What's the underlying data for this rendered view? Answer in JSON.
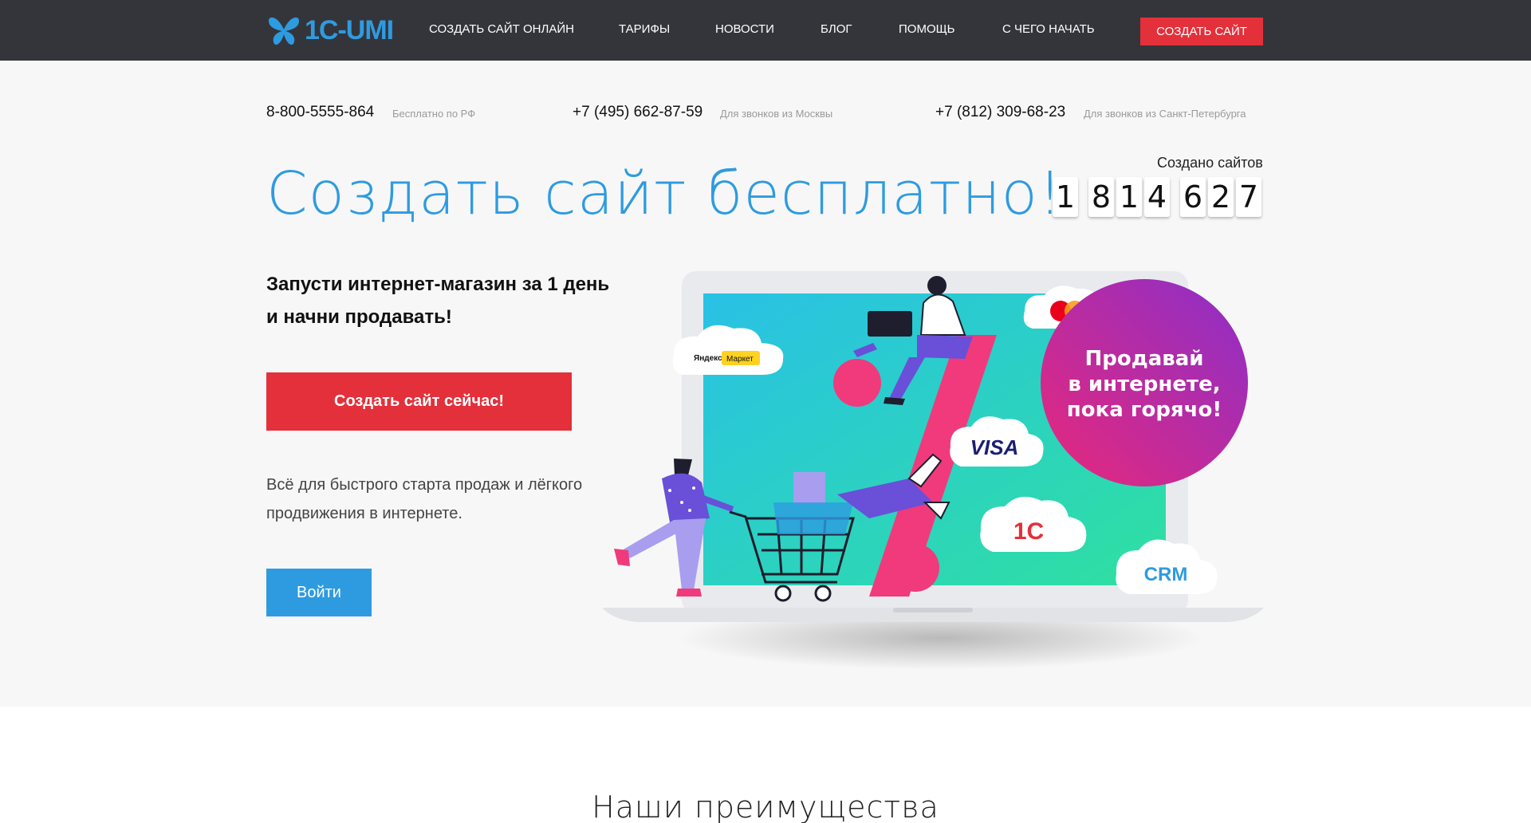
{
  "header": {
    "logo_text": "1C-UMI",
    "nav": [
      "СОЗДАТЬ САЙТ ОНЛАЙН",
      "ТАРИФЫ",
      "НОВОСТИ",
      "БЛОГ",
      "ПОМОЩЬ",
      "С ЧЕГО НАЧАТЬ"
    ],
    "cta_label": "СОЗДАТЬ САЙТ"
  },
  "phones": [
    {
      "number": "8-800-5555-864",
      "note": "Бесплатно по РФ"
    },
    {
      "number": "+7 (495) 662-87-59",
      "note": "Для звонков из Москвы"
    },
    {
      "number": "+7 (812) 309-68-23",
      "note": "Для звонков из Санкт-Петербурга"
    }
  ],
  "hero": {
    "headline": "Создать сайт бесплатно!",
    "counter_label": "Создано сайтов",
    "counter_digits": [
      "1",
      "8",
      "1",
      "4",
      "6",
      "2",
      "7"
    ],
    "sub_line1": "Запусти интернет-магазин за 1 день",
    "sub_line2": "и начни продавать!",
    "create_button": "Создать сайт сейчас!",
    "description": "Всё для быстрого старта продаж и лёгкого продвижения в интернете.",
    "login_button": "Войти"
  },
  "illustration": {
    "circle_line1": "Продавай",
    "circle_line2": "в интернете,",
    "circle_line3": "пока горячо!",
    "cloud_yandex_1": "Яндекс",
    "cloud_yandex_2": "Маркет",
    "cloud_visa": "VISA",
    "cloud_1c": "1С",
    "cloud_crm": "CRM",
    "colors": {
      "screen_from": "#29c1e6",
      "screen_to": "#2ee0a0",
      "circle_from": "#e8287a",
      "circle_to": "#8b2fc9",
      "accent_red": "#e3303a",
      "accent_blue": "#2e9be0"
    }
  },
  "advantages": {
    "title": "Наши преимущества"
  }
}
